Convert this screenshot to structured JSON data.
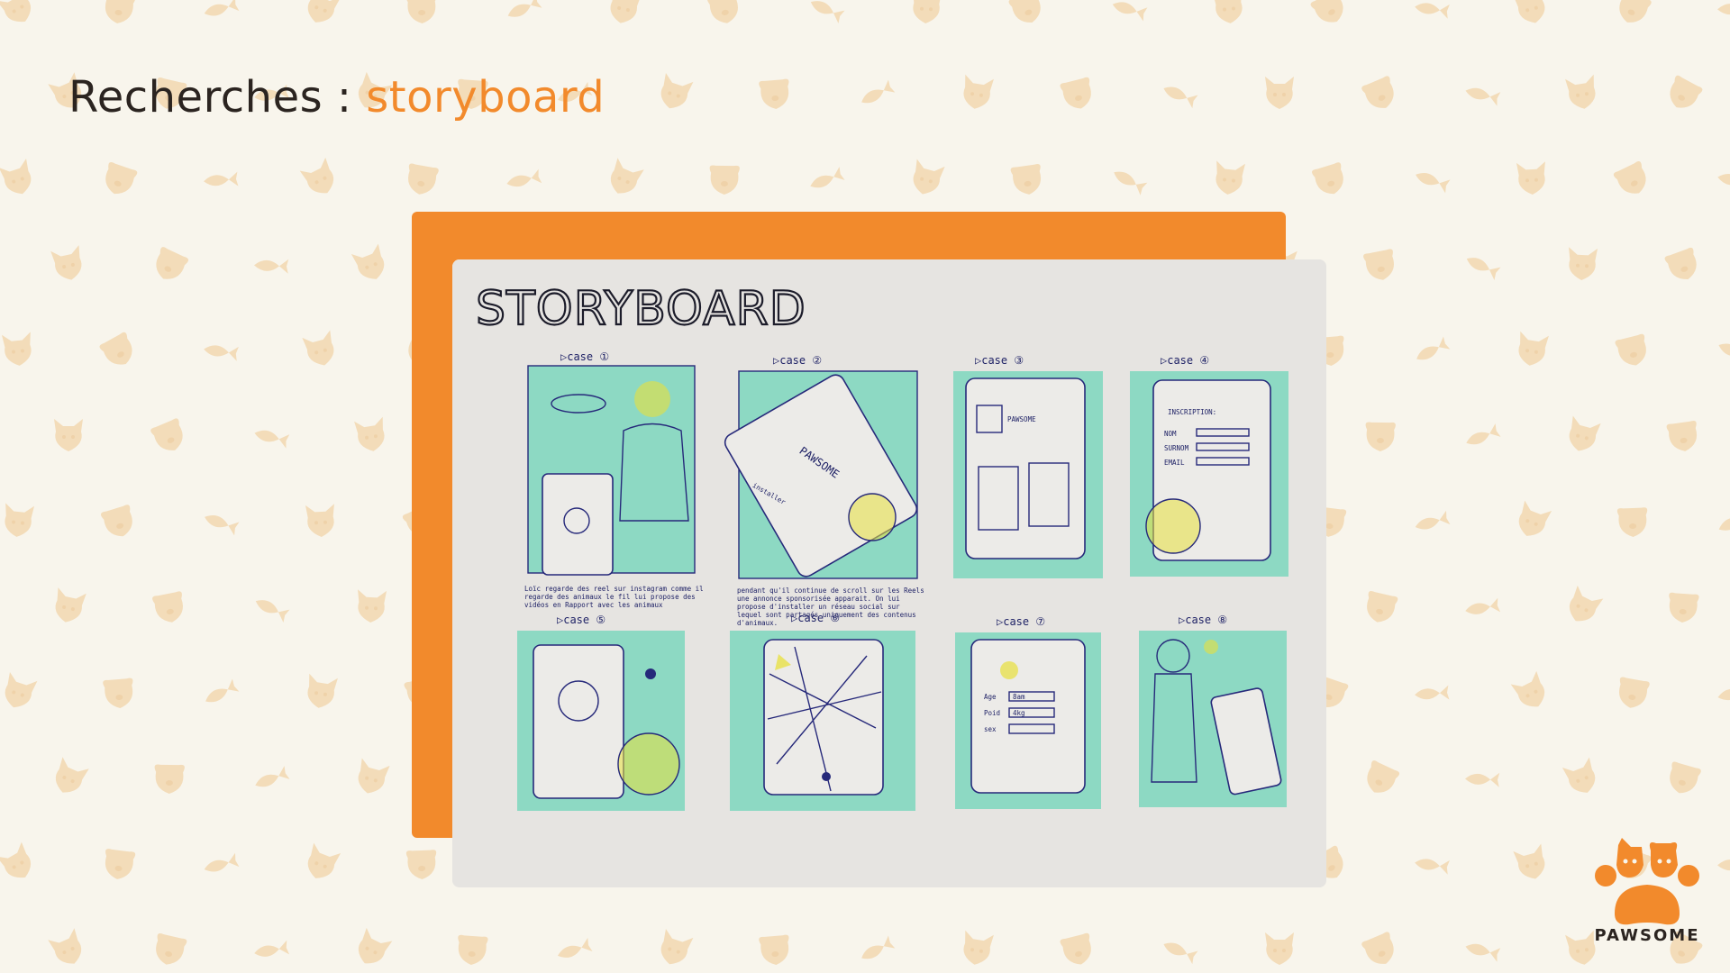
{
  "slide": {
    "title_prefix": "Recherches : ",
    "title_accent": "storyboard"
  },
  "storyboard": {
    "heading": "STORYBOARD",
    "panels": [
      {
        "label": "▷case ①"
      },
      {
        "label": "▷case ②"
      },
      {
        "label": "▷case ③"
      },
      {
        "label": "▷case ④"
      },
      {
        "label": "▷case ⑤"
      },
      {
        "label": "▷case ⑥"
      },
      {
        "label": "▷case ⑦"
      },
      {
        "label": "▷case ⑧"
      }
    ],
    "app_name_sketch": "PAWSOME",
    "install_sketch": "installer",
    "signup_sketch": "INSCRIPTION:",
    "signup_fields": [
      "NOM",
      "SURNOM",
      "EMAIL"
    ],
    "profile_fields": [
      "Age",
      "Poid",
      "sex"
    ],
    "profile_values": [
      "8am",
      "4kg"
    ],
    "caption_1": "Loïc regarde des reel sur instagram comme il regarde des animaux le fil lui propose des vidéos en Rapport avec les animaux",
    "caption_2": "pendant qu'il continue de scroll sur les Reels une annonce sponsorisée apparait. On lui propose d'installer un réseau social sur lequel sont partagés uniquement des contenus d'animaux."
  },
  "brand": {
    "name": "PAWSOME",
    "accent_color": "#f28a2c",
    "icon": "paw-with-cat-and-dog-icon"
  },
  "colors": {
    "background": "#f8f5ec",
    "accent": "#f28a2c",
    "teal_marker": "#6fd6b8",
    "ink": "#26297a"
  }
}
